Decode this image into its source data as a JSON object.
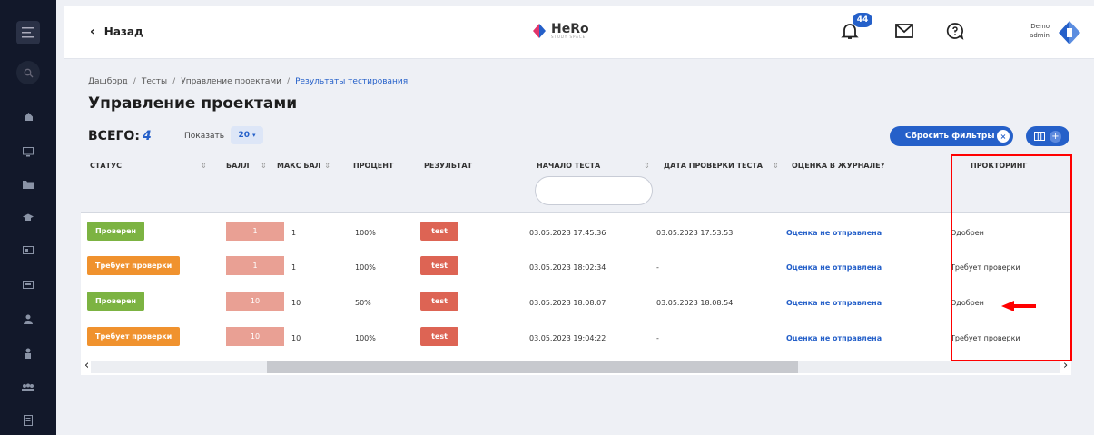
{
  "header": {
    "back_label": "Назад",
    "logo": {
      "name": "HeRo",
      "sub": "STUDY SPACE"
    },
    "notifications_count": "44",
    "user": {
      "line1": "Demo",
      "line2": "admin"
    }
  },
  "breadcrumbs": [
    "Дашборд",
    "Тесты",
    "Управление проектами",
    "Результаты тестирования"
  ],
  "page_title": "Управление проектами",
  "summary": {
    "total_label": "ВСЕГО:",
    "total_value": "4",
    "show_label": "Показать",
    "page_size": "20"
  },
  "toolbar": {
    "reset_filters_label": "Сбросить фильтры",
    "reset_x": "×",
    "plus": "+"
  },
  "table": {
    "headers": {
      "status": "СТАТУС",
      "score": "БАЛЛ",
      "max_score": "МАКС БАЛ",
      "percent": "ПРОЦЕНТ",
      "result": "РЕЗУЛЬТАТ",
      "start": "НАЧАЛО ТЕСТА",
      "checked": "ДАТА ПРОВЕРКИ ТЕСТА",
      "journal": "ОЦЕНКА В ЖУРНАЛЕ?",
      "proctoring": "ПРОКТОРИНГ"
    },
    "sort_symbol": "⇕",
    "rows": [
      {
        "status": "Проверен",
        "status_color": "#7cb342",
        "score": "1",
        "max_score": "1",
        "percent": "100%",
        "result": "test",
        "start": "03.05.2023 17:45:36",
        "checked": "03.05.2023 17:53:53",
        "journal": "Оценка не отправлена",
        "proctoring": "Одобрен"
      },
      {
        "status": "Требует проверки",
        "status_color": "#f0922e",
        "score": "1",
        "max_score": "1",
        "percent": "100%",
        "result": "test",
        "start": "03.05.2023 18:02:34",
        "checked": "-",
        "journal": "Оценка не отправлена",
        "proctoring": "Требует проверки"
      },
      {
        "status": "Проверен",
        "status_color": "#7cb342",
        "score": "10",
        "max_score": "10",
        "percent": "50%",
        "result": "test",
        "start": "03.05.2023 18:08:07",
        "checked": "03.05.2023 18:08:54",
        "journal": "Оценка не отправлена",
        "proctoring": "Одобрен"
      },
      {
        "status": "Требует проверки",
        "status_color": "#f0922e",
        "score": "10",
        "max_score": "10",
        "percent": "100%",
        "result": "test",
        "start": "03.05.2023 19:04:22",
        "checked": "-",
        "journal": "Оценка не отправлена",
        "proctoring": "Требует проверки"
      }
    ]
  },
  "scroll": {
    "left": "‹",
    "right": "›"
  },
  "colors": {
    "accent": "#2560c9",
    "sidebar": "#12182a",
    "result_btn": "#dd6454",
    "score_bg": "#e9a094",
    "highlight": "#ff0000"
  },
  "sidebar_icons": [
    "menu-icon",
    "search-icon",
    "home-icon",
    "monitor-icon",
    "folder-icon",
    "graduation-cap-icon",
    "presentation-icon",
    "screen-icon",
    "users-icon",
    "user-badge-icon",
    "group-icon",
    "document-icon"
  ]
}
